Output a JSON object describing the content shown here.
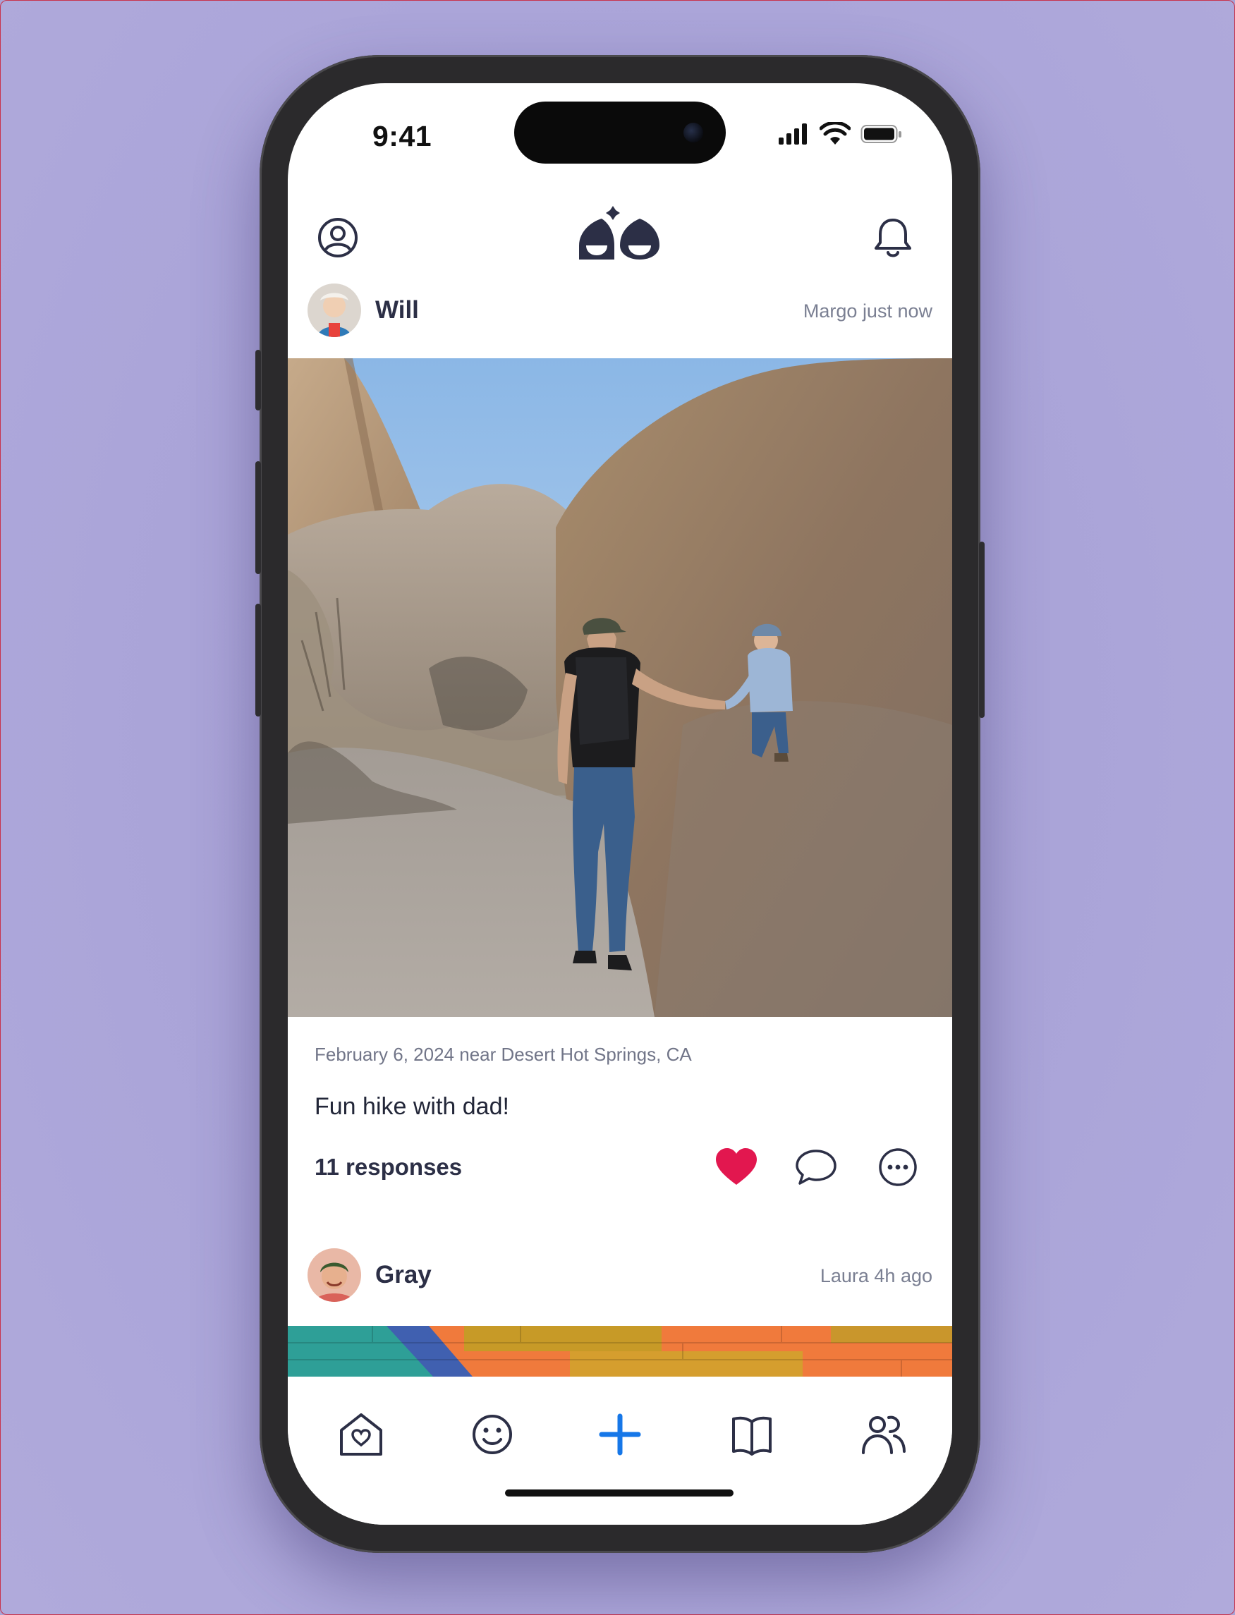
{
  "status_bar": {
    "time": "9:41"
  },
  "header": {
    "profile_icon": "user-circle-icon",
    "logo_icon": "app-logo",
    "notifications_icon": "bell-icon"
  },
  "posts": [
    {
      "child_name": "Will",
      "meta": "Margo just now",
      "date_location": "February 6, 2024 near Desert Hot Springs, CA",
      "caption": "Fun hike with dad!",
      "responses": "11 responses",
      "liked": true
    },
    {
      "child_name": "Gray",
      "meta": "Laura 4h ago"
    }
  ],
  "actions": {
    "like_icon": "heart-icon",
    "comment_icon": "speech-bubble-icon",
    "more_icon": "ellipsis-circle-icon"
  },
  "tabbar": [
    {
      "icon": "home-heart-icon"
    },
    {
      "icon": "smiley-icon"
    },
    {
      "icon": "plus-icon"
    },
    {
      "icon": "book-icon"
    },
    {
      "icon": "people-icon"
    }
  ],
  "colors": {
    "background": "#a9a3d6",
    "accent_blue": "#1677e8",
    "heart": "#e2174f",
    "ink": "#2c2f46"
  }
}
